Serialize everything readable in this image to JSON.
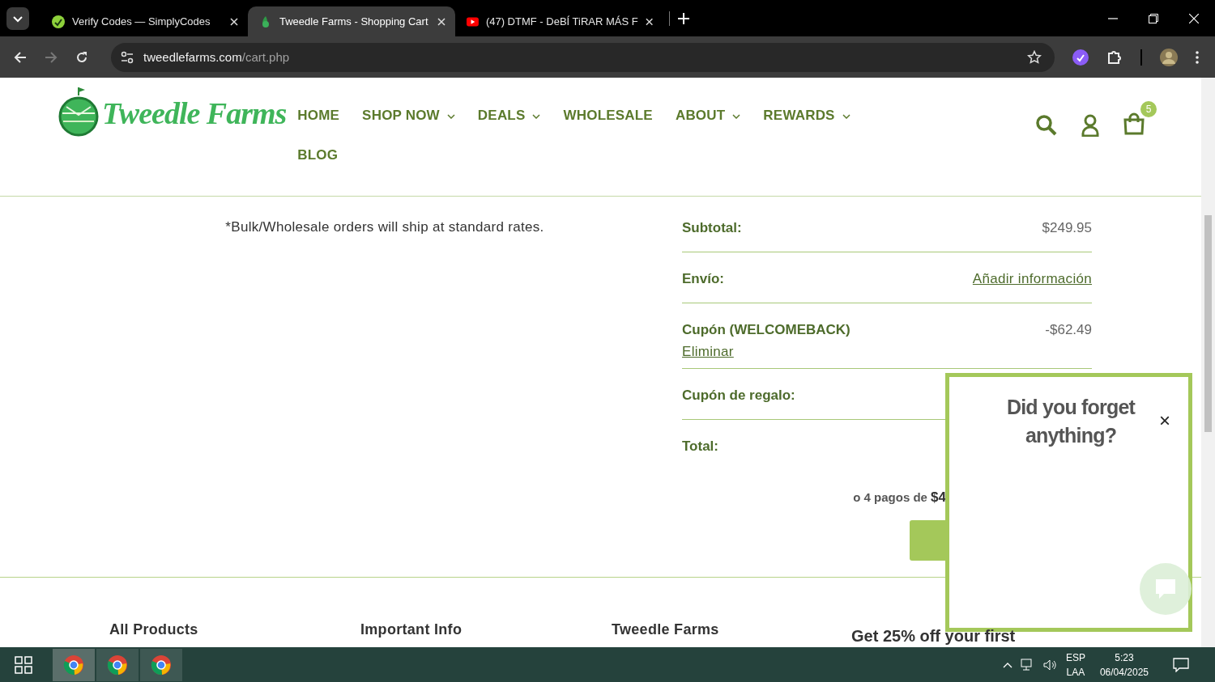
{
  "browser": {
    "tabs": [
      {
        "title": "Verify Codes — SimplyCodes",
        "selected": false
      },
      {
        "title": "Tweedle Farms - Shopping Cart",
        "selected": true
      },
      {
        "title": "(47) DTMF - DeBÍ TiRAR MÁS F",
        "selected": false
      }
    ],
    "address": {
      "domain": "tweedlefarms.com",
      "path": "/cart.php"
    }
  },
  "header": {
    "logo": "Tweedle Farms",
    "nav": [
      {
        "label": "HOME",
        "dropdown": false
      },
      {
        "label": "SHOP NOW",
        "dropdown": true
      },
      {
        "label": "DEALS",
        "dropdown": true
      },
      {
        "label": "WHOLESALE",
        "dropdown": false
      },
      {
        "label": "ABOUT",
        "dropdown": true
      },
      {
        "label": "REWARDS",
        "dropdown": true
      },
      {
        "label": "BLOG",
        "dropdown": false
      }
    ],
    "cart_count": "5"
  },
  "cart": {
    "note": "*Bulk/Wholesale orders will ship at standard rates.",
    "rows": [
      {
        "label": "Subtotal:",
        "value": "$249.95"
      },
      {
        "label": "Envío:",
        "link": "Añadir información"
      },
      {
        "label": "Cupón (WELCOMEBACK)",
        "value": "-$62.49",
        "sublink": "Eliminar"
      },
      {
        "label": "Cupón de regalo:"
      },
      {
        "label": "Total:"
      }
    ],
    "installments": {
      "prefix": "o 4 pagos de",
      "amount": "$4"
    }
  },
  "popup": {
    "title": "Did you forget anything?",
    "close": "×"
  },
  "footer": {
    "columns": [
      "All Products",
      "Important Info",
      "Tweedle Farms"
    ],
    "promo": "Get 25% off your first"
  },
  "taskbar": {
    "apps": [
      {
        "selected": true
      },
      {
        "selected": false
      },
      {
        "selected": false
      }
    ],
    "language": "ESP",
    "layout": "LAA",
    "time": "5:23",
    "date": "06/04/2025"
  }
}
